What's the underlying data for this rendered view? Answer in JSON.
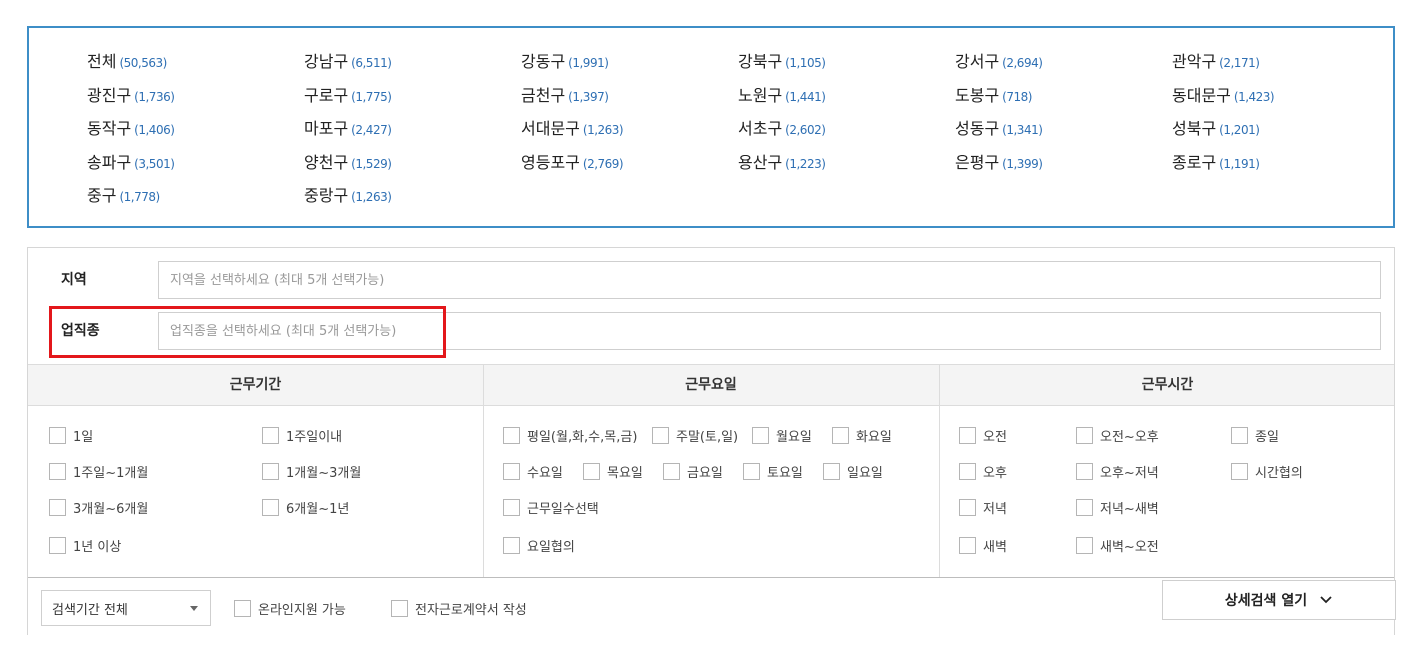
{
  "regions": [
    {
      "name": "전체",
      "count": "(50,563)"
    },
    {
      "name": "강남구",
      "count": "(6,511)"
    },
    {
      "name": "강동구",
      "count": "(1,991)"
    },
    {
      "name": "강북구",
      "count": "(1,105)"
    },
    {
      "name": "강서구",
      "count": "(2,694)"
    },
    {
      "name": "관악구",
      "count": "(2,171)"
    },
    {
      "name": "광진구",
      "count": "(1,736)"
    },
    {
      "name": "구로구",
      "count": "(1,775)"
    },
    {
      "name": "금천구",
      "count": "(1,397)"
    },
    {
      "name": "노원구",
      "count": "(1,441)"
    },
    {
      "name": "도봉구",
      "count": "(718)"
    },
    {
      "name": "동대문구",
      "count": "(1,423)"
    },
    {
      "name": "동작구",
      "count": "(1,406)"
    },
    {
      "name": "마포구",
      "count": "(2,427)"
    },
    {
      "name": "서대문구",
      "count": "(1,263)"
    },
    {
      "name": "서초구",
      "count": "(2,602)"
    },
    {
      "name": "성동구",
      "count": "(1,341)"
    },
    {
      "name": "성북구",
      "count": "(1,201)"
    },
    {
      "name": "송파구",
      "count": "(3,501)"
    },
    {
      "name": "양천구",
      "count": "(1,529)"
    },
    {
      "name": "영등포구",
      "count": "(2,769)"
    },
    {
      "name": "용산구",
      "count": "(1,223)"
    },
    {
      "name": "은평구",
      "count": "(1,399)"
    },
    {
      "name": "종로구",
      "count": "(1,191)"
    },
    {
      "name": "중구",
      "count": "(1,778)"
    },
    {
      "name": "중랑구",
      "count": "(1,263)"
    }
  ],
  "fields": {
    "region_label": "지역",
    "region_placeholder": "지역을 선택하세요 (최대 5개 선택가능)",
    "job_label": "업직종",
    "job_placeholder": "업직종을 선택하세요 (최대 5개 선택가능)"
  },
  "columns": {
    "period": {
      "header": "근무기간",
      "options": [
        "1일",
        "1주일이내",
        "1주일~1개월",
        "1개월~3개월",
        "3개월~6개월",
        "6개월~1년",
        "1년 이상"
      ]
    },
    "days": {
      "header": "근무요일",
      "options": [
        "평일(월,화,수,목,금)",
        "주말(토,일)",
        "월요일",
        "화요일",
        "수요일",
        "목요일",
        "금요일",
        "토요일",
        "일요일",
        "근무일수선택",
        "요일협의"
      ]
    },
    "time": {
      "header": "근무시간",
      "options": [
        "오전",
        "오전~오후",
        "종일",
        "오후",
        "오후~저녁",
        "시간협의",
        "저녁",
        "저녁~새벽",
        "새벽",
        "새벽~오전"
      ]
    }
  },
  "bottom": {
    "period_select": "검색기간 전체",
    "online_apply": "온라인지원 가능",
    "e_contract": "전자근로계약서 작성",
    "detail_button": "상세검색 열기"
  },
  "colors": {
    "panel_border": "#3e8ec7",
    "count_text": "#2e6fb3",
    "highlight": "#e3171b"
  }
}
